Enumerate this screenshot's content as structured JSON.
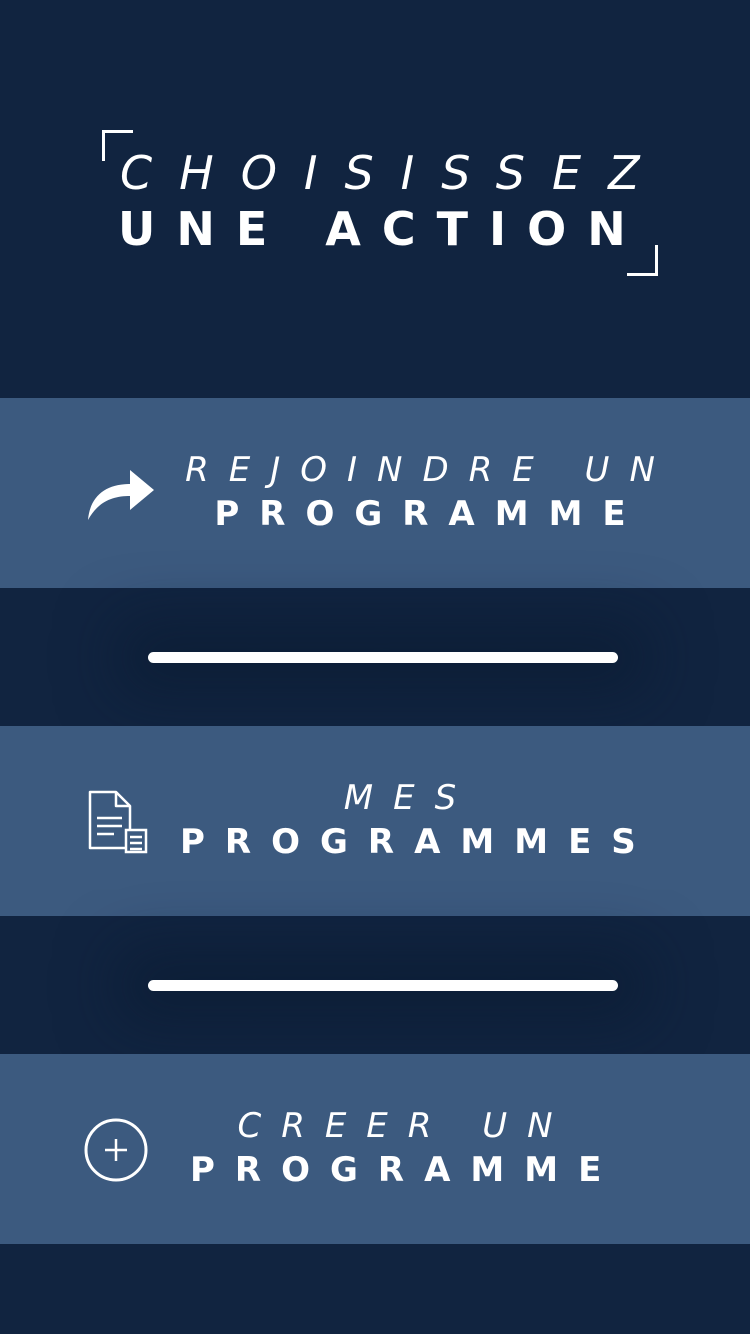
{
  "header": {
    "title_line1": "CHOISISSEZ",
    "title_line2": "UNE ACTION"
  },
  "actions": [
    {
      "icon": "share-arrow-icon",
      "line1": "REJOINDRE UN",
      "line2": "PROGRAMME"
    },
    {
      "icon": "document-icon",
      "line1": "MES",
      "line2": "PROGRAMMES"
    },
    {
      "icon": "plus-circle-icon",
      "line1": "CREER UN",
      "line2": "PROGRAMME"
    }
  ],
  "colors": {
    "background": "#112440",
    "button": "#3c5a7f",
    "text": "#ffffff"
  }
}
